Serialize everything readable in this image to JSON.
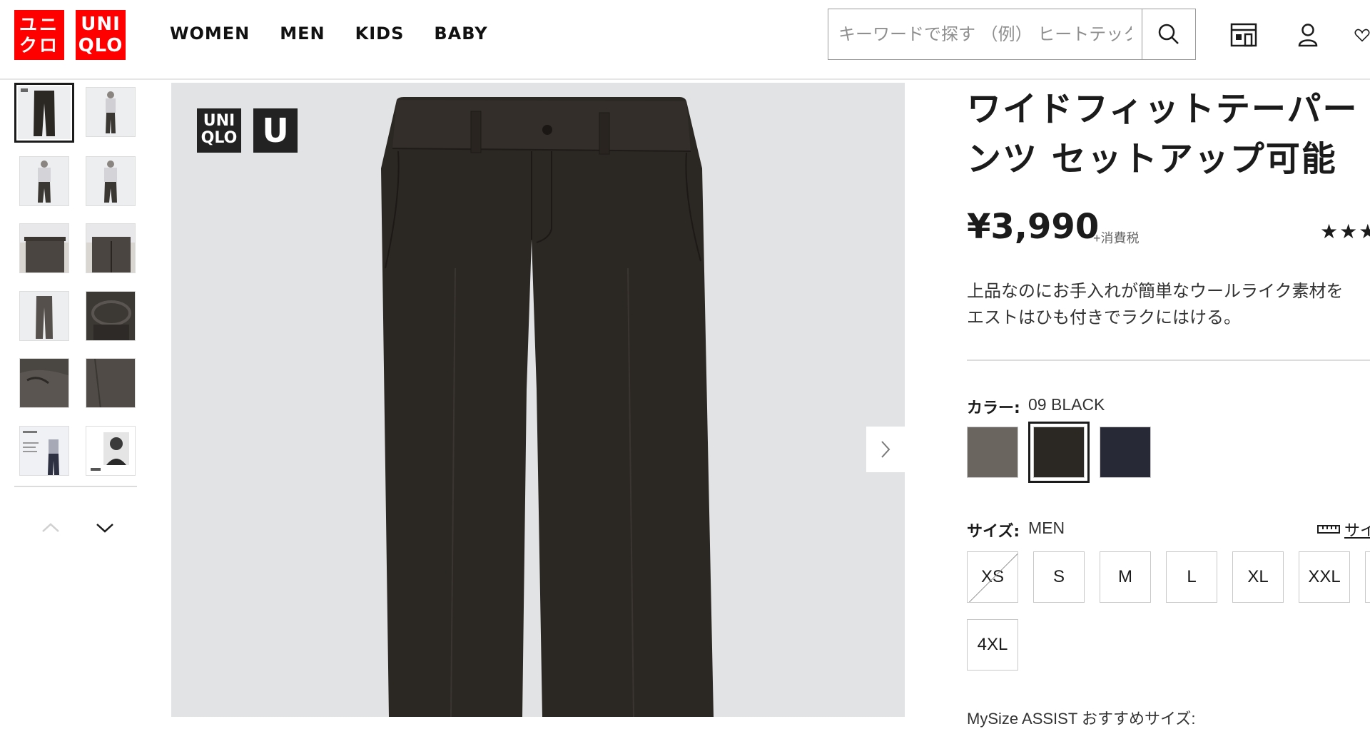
{
  "header": {
    "logo_kana": "ユニ\nクロ",
    "logo_en": "UNI\nQLO",
    "nav": [
      "WOMEN",
      "MEN",
      "KIDS",
      "BABY"
    ],
    "search_placeholder": "キーワードで探す （例） ヒートテック"
  },
  "product": {
    "title": "ワイドフィットテーパードパンツ セットアップ可能",
    "title_display": "ワイドフィットテーパー\nンツ セットアップ可能",
    "price": "¥3,990",
    "tax_note": "+消費税",
    "stars": "★★★",
    "description_line1": "上品なのにお手入れが簡単なウールライク素材を",
    "description_line2": "エストはひも付きでラクにはける。",
    "badge_uniqlo": "UNI\nQLO",
    "badge_u": "U"
  },
  "color": {
    "label": "カラー:",
    "selected": "09 BLACK",
    "swatches": [
      {
        "name": "gray",
        "hex": "#6b6560"
      },
      {
        "name": "black",
        "hex": "#2b2723",
        "selected": true
      },
      {
        "name": "navy",
        "hex": "#272a36"
      }
    ]
  },
  "size": {
    "label": "サイズ:",
    "selected_group": "MEN",
    "guide_label": "サイズ",
    "options": [
      {
        "label": "XS",
        "available": false
      },
      {
        "label": "S",
        "available": true
      },
      {
        "label": "M",
        "available": true
      },
      {
        "label": "L",
        "available": true
      },
      {
        "label": "XL",
        "available": true
      },
      {
        "label": "XXL",
        "available": true
      },
      {
        "label": "4XL",
        "available": true
      }
    ]
  },
  "mysize": "MySize ASSIST おすすめサイズ:",
  "colors": {
    "brand_red": "#ff0000",
    "image_bg": "#e2e3e5",
    "pants": "#2b2723"
  }
}
